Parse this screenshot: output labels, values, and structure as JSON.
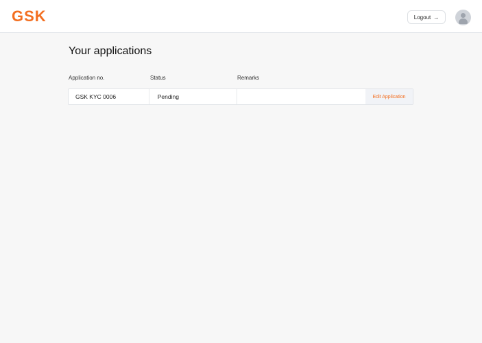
{
  "header": {
    "logo": "GSK",
    "logout_label": "Logout",
    "logout_icon": "arrow-right-icon",
    "avatar_icon": "user-icon"
  },
  "main": {
    "title": "Your applications",
    "columns": [
      "Application no.",
      "Status",
      "Remarks"
    ],
    "rows": [
      {
        "application_no": "GSK KYC 0006",
        "status": "Pending",
        "remarks": "",
        "action": "Edit Application"
      }
    ]
  },
  "colors": {
    "accent": "#f36f21"
  }
}
